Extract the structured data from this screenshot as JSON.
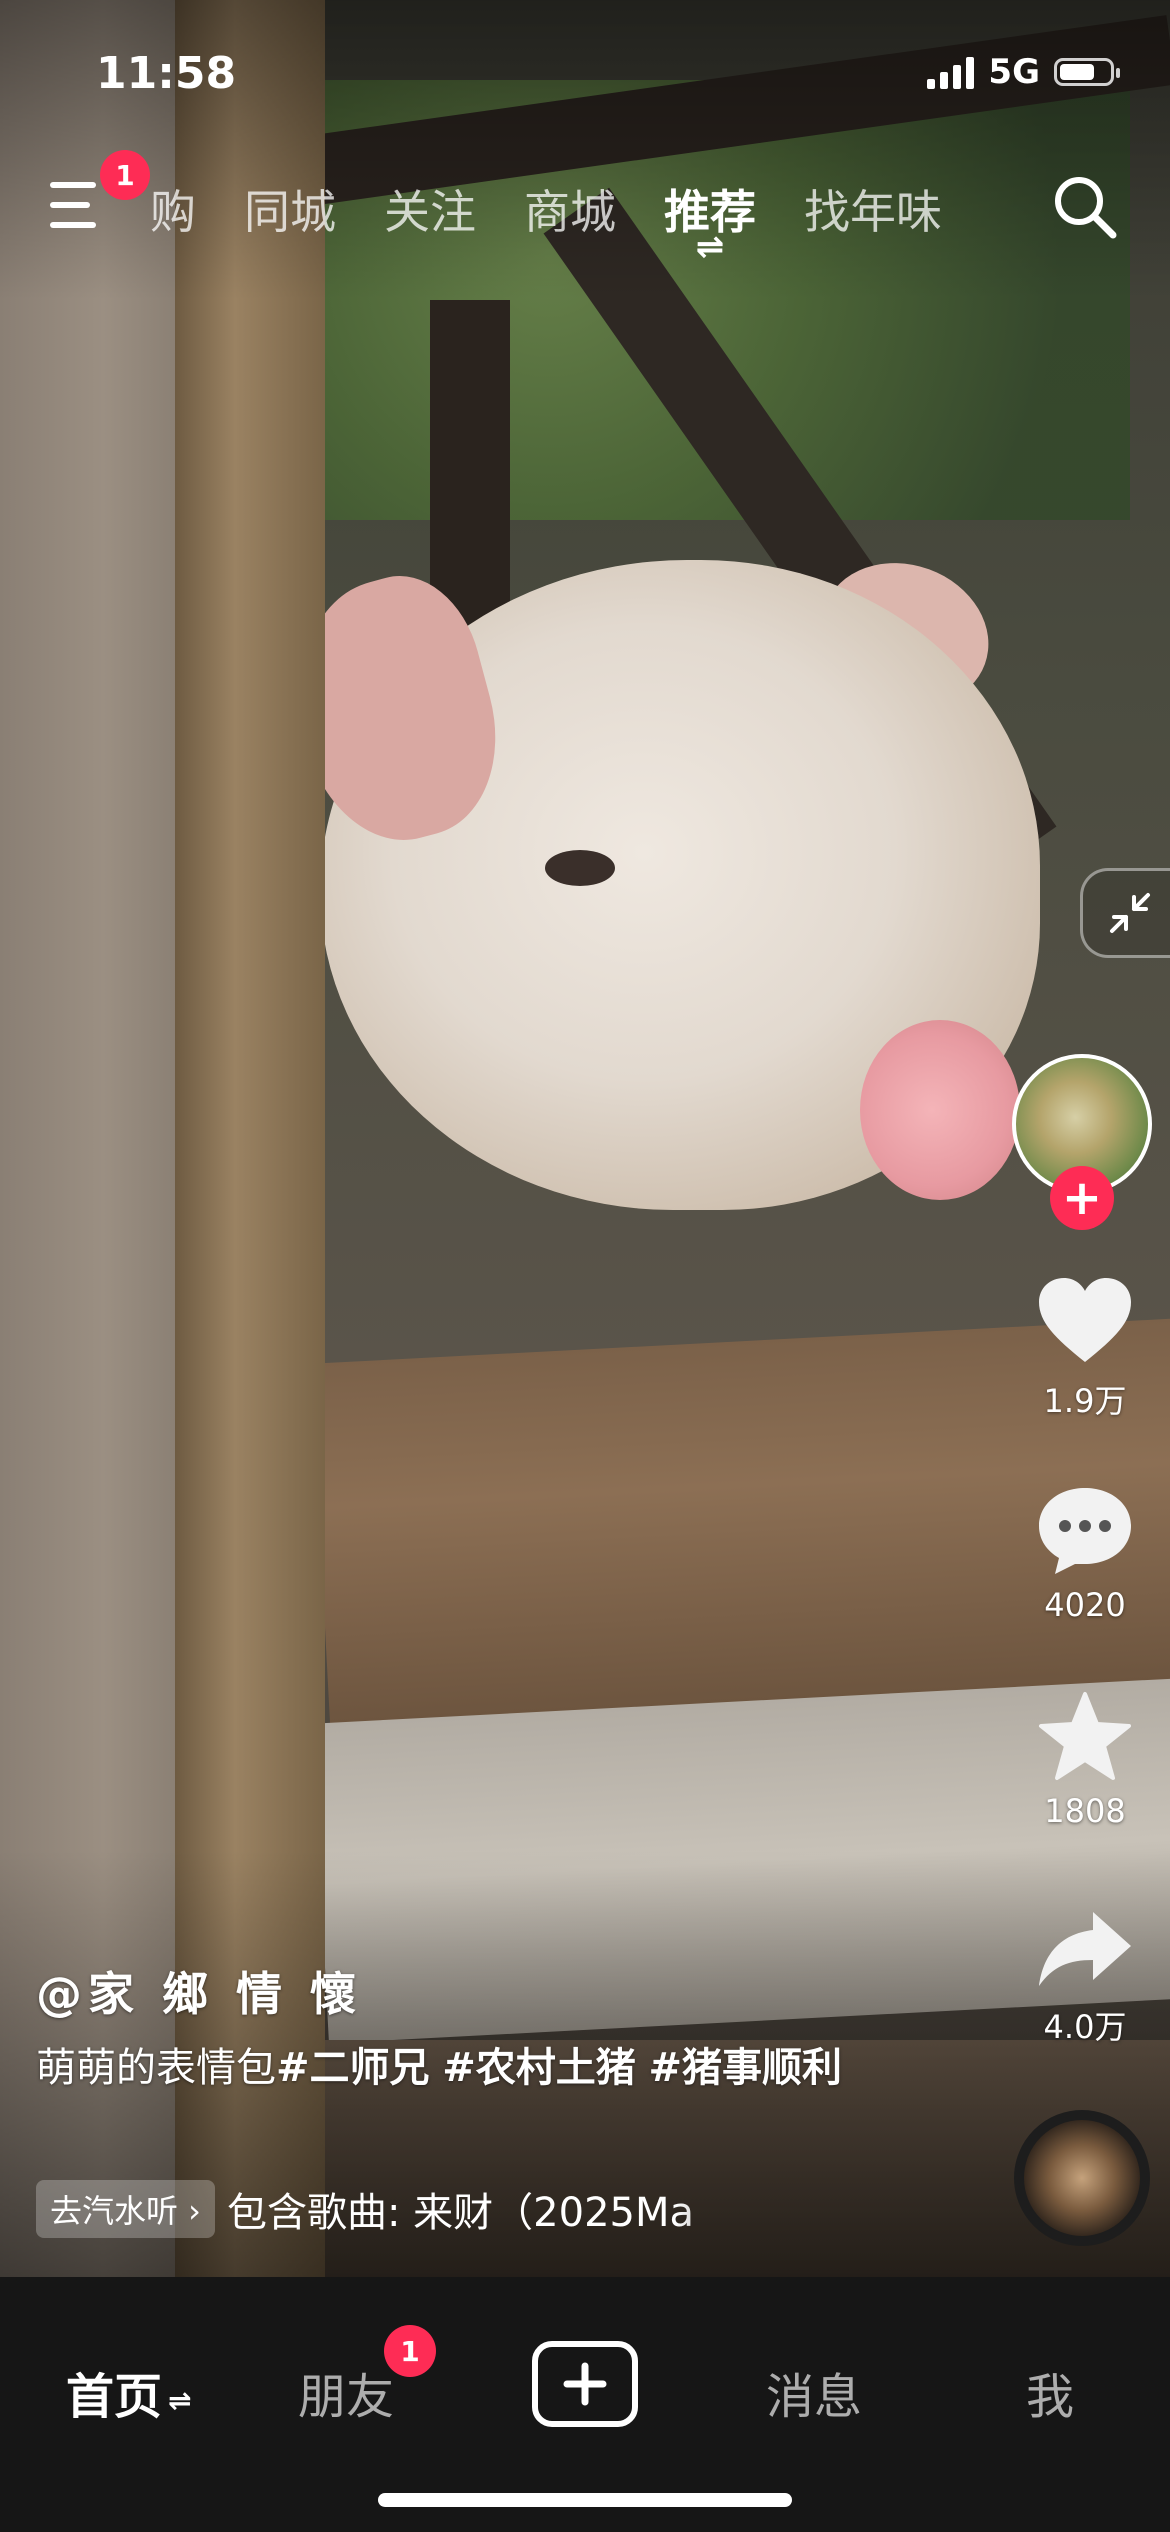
{
  "status_bar": {
    "time": "11:58",
    "network": "5G"
  },
  "top_nav": {
    "menu_badge": "1",
    "tabs": [
      {
        "label": "购"
      },
      {
        "label": "同城"
      },
      {
        "label": "关注"
      },
      {
        "label": "商城"
      },
      {
        "label": "推荐",
        "swap_icon": "⇌"
      },
      {
        "label": "找年味"
      }
    ]
  },
  "right_rail": {
    "likes": "1.9万",
    "comments": "4020",
    "favorites": "1808",
    "shares": "4.0万",
    "follow_symbol": "+"
  },
  "caption": {
    "author": "@家 鄉 情 懷",
    "text": "萌萌的表情包",
    "hashtags": [
      "#二师兄",
      "#农村土猪",
      "#猪事顺利"
    ],
    "music_chip": "去汽水听 ›",
    "music_text": "包含歌曲: 来财（2025Ma"
  },
  "bottom_nav": {
    "home": "首页",
    "home_swap": "⇌",
    "friends": "朋友",
    "friends_badge": "1",
    "messages": "消息",
    "me": "我"
  },
  "colors": {
    "accent": "#fe2c55",
    "nav_bg": "#161616"
  }
}
